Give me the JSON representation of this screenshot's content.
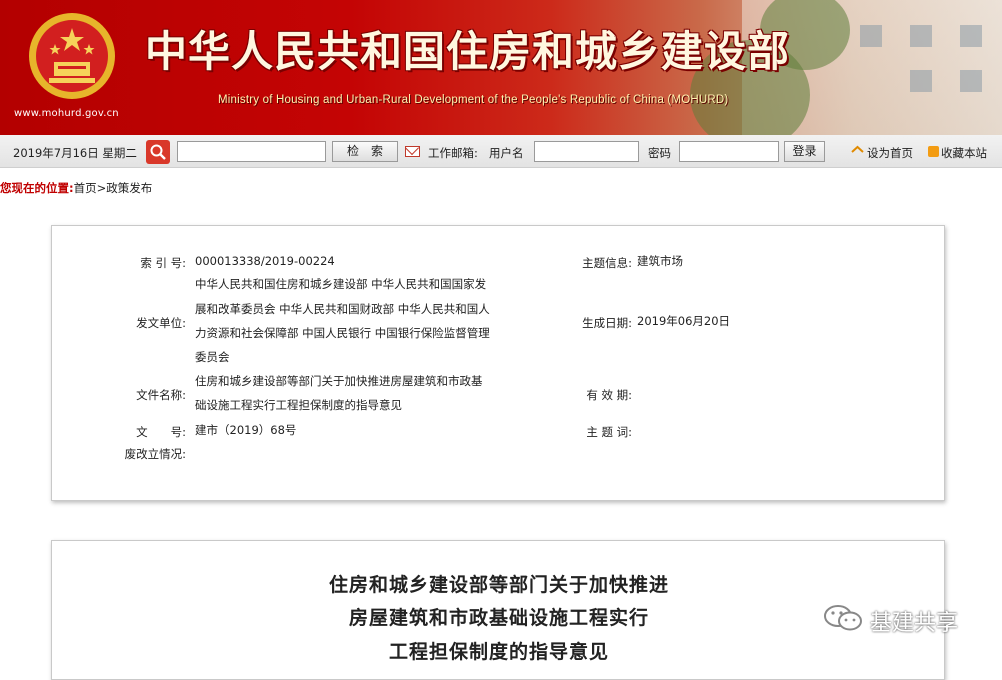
{
  "banner": {
    "title": "中华人民共和国住房和城乡建设部",
    "subtitle": "Ministry of Housing and Urban-Rural Development of the People's Republic of China (MOHURD)",
    "url": "www.mohurd.gov.cn",
    "emblem": "national-emblem-icon"
  },
  "toolbar": {
    "date": "2019年7月16日 星期二",
    "search_input_value": "",
    "search_button": "检　索",
    "mail_label": "工作邮箱:",
    "username_label": "用户名",
    "username_value": "",
    "password_label": "密码",
    "password_value": "",
    "login_button": "登录",
    "set_home": "设为首页",
    "bookmark": "收藏本站"
  },
  "breadcrumb": {
    "label": "您现在的位置:",
    "path": "首页>政策发布"
  },
  "info": {
    "index_label": "索 引 号:",
    "index_value": "000013338/2019-00224",
    "topic_label": "主题信息:",
    "topic_value": "建筑市场",
    "issuer_label": "发文单位:",
    "issuer_lines": [
      "中华人民共和国住房和城乡建设部 中华人民共和国国家发",
      "展和改革委员会 中华人民共和国财政部 中华人民共和国人",
      "力资源和社会保障部 中国人民银行 中国银行保险监督管理",
      "委员会"
    ],
    "date_label": "生成日期:",
    "date_value": "2019年06月20日",
    "filename_label": "文件名称:",
    "filename_lines": [
      "住房和城乡建设部等部门关于加快推进房屋建筑和市政基",
      "础设施工程实行工程担保制度的指导意见"
    ],
    "valid_label": "有 效 期:",
    "valid_value": "",
    "docno_label": "文　　号:",
    "docno_value": "建市（2019）68号",
    "keywords_label": "主 题 词:",
    "keywords_value": "",
    "status_label": "废改立情况:",
    "status_value": ""
  },
  "document": {
    "title_lines": [
      "住房和城乡建设部等部门关于加快推进",
      "房屋建筑和市政基础设施工程实行",
      "工程担保制度的指导意见"
    ]
  },
  "watermark": {
    "text": "基建共享",
    "icon": "wechat-icon"
  }
}
